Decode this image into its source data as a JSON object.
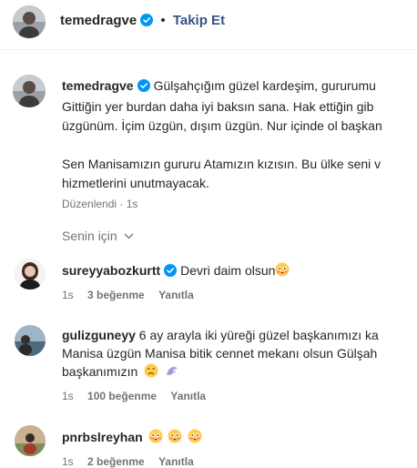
{
  "header": {
    "username": "temedragve",
    "separator": "•",
    "follow_label": "Takip Et"
  },
  "caption": {
    "username": "temedragve",
    "lines": [
      "Gülşahçığım güzel kardeşim, gururumu",
      "Gittiğin yer burdan daha iyi baksın sana. Hak ettiğin gib",
      "üzgünüm. İçim üzgün, dışım üzgün. Nur içinde ol başkan",
      "",
      "Sen Manisamızın gururu Atamızın kızısın. Bu ülke seni v",
      "hizmetlerini unutmayacak."
    ],
    "meta": "Düzenlendi · 1s"
  },
  "sort": {
    "label": "Senin için"
  },
  "comments": [
    {
      "username": "sureyyabozkurtt",
      "lines": [
        "Devri daim olsun"
      ],
      "emojis": [
        "flushed-emoji"
      ],
      "time": "1s",
      "likes": "3 beğenme",
      "reply": "Yanıtla"
    },
    {
      "username": "gulizguneyy",
      "lines": [
        "6 ay arayla iki yüreği güzel başkanımızı ka",
        "Manisa üzgün Manisa bitik cennet mekanı olsun Gülşah",
        "başkanımızın"
      ],
      "emojis": [
        "sad-emoji",
        "wave-emoji"
      ],
      "time": "1s",
      "likes": "100 beğenme",
      "reply": "Yanıtla"
    },
    {
      "username": "pnrbslreyhan",
      "lines": [
        ""
      ],
      "emojis": [
        "flushed-emoji",
        "flushed-emoji",
        "flushed-emoji"
      ],
      "time": "1s",
      "likes": "2 beğenme",
      "reply": "Yanıtla"
    }
  ],
  "colors": {
    "verified": "#0095f6",
    "follow": "#385185",
    "secondary_text": "#737373",
    "primary_text": "#262626"
  }
}
